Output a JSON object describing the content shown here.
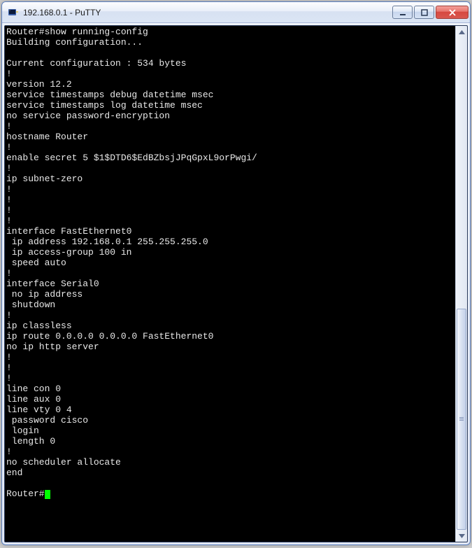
{
  "window": {
    "title_ip": "192.168.0.1",
    "title_app": "PuTTY"
  },
  "terminal": {
    "prompt1": "Router#",
    "command": "show running-config",
    "lines": [
      "Building configuration...",
      "",
      "Current configuration : 534 bytes",
      "!",
      "version 12.2",
      "service timestamps debug datetime msec",
      "service timestamps log datetime msec",
      "no service password-encryption",
      "!",
      "hostname Router",
      "!",
      "enable secret 5 $1$DTD6$EdBZbsjJPqGpxL9orPwgi/",
      "!",
      "ip subnet-zero",
      "!",
      "!",
      "!",
      "!",
      "interface FastEthernet0",
      " ip address 192.168.0.1 255.255.255.0",
      " ip access-group 100 in",
      " speed auto",
      "!",
      "interface Serial0",
      " no ip address",
      " shutdown",
      "!",
      "ip classless",
      "ip route 0.0.0.0 0.0.0.0 FastEthernet0",
      "no ip http server",
      "!",
      "!",
      "!",
      "line con 0",
      "line aux 0",
      "line vty 0 4",
      " password cisco",
      " login",
      " length 0",
      "!",
      "no scheduler allocate",
      "end",
      ""
    ],
    "prompt2": "Router#"
  }
}
